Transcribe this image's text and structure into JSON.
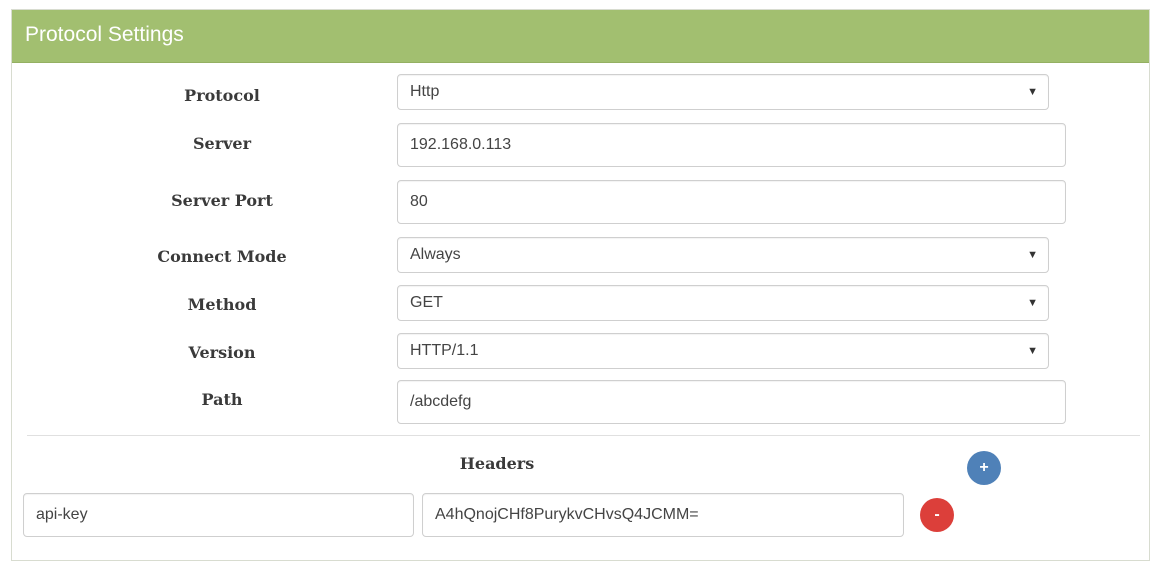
{
  "panel": {
    "title": "Protocol Settings"
  },
  "form": {
    "protocol": {
      "label": "Protocol",
      "value": "Http"
    },
    "server": {
      "label": "Server",
      "value": "192.168.0.113"
    },
    "server_port": {
      "label": "Server Port",
      "value": "80"
    },
    "connect_mode": {
      "label": "Connect Mode",
      "value": "Always"
    },
    "method": {
      "label": "Method",
      "value": "GET"
    },
    "version": {
      "label": "Version",
      "value": "HTTP/1.1"
    },
    "path": {
      "label": "Path",
      "value": "/abcdefg"
    }
  },
  "headers": {
    "label": "Headers",
    "add_button": "+",
    "rows": [
      {
        "key": "api-key",
        "value": "A4hQnojCHf8PurykvCHvsQ4JCMM=",
        "remove_button": "-"
      }
    ]
  },
  "colors": {
    "header_bar": "#a2bf70",
    "add_button": "#4f81b8",
    "remove_button": "#dc3f3a"
  },
  "icons": {
    "select_arrow": "chevron-down-icon",
    "add": "plus-icon",
    "remove": "minus-icon"
  }
}
